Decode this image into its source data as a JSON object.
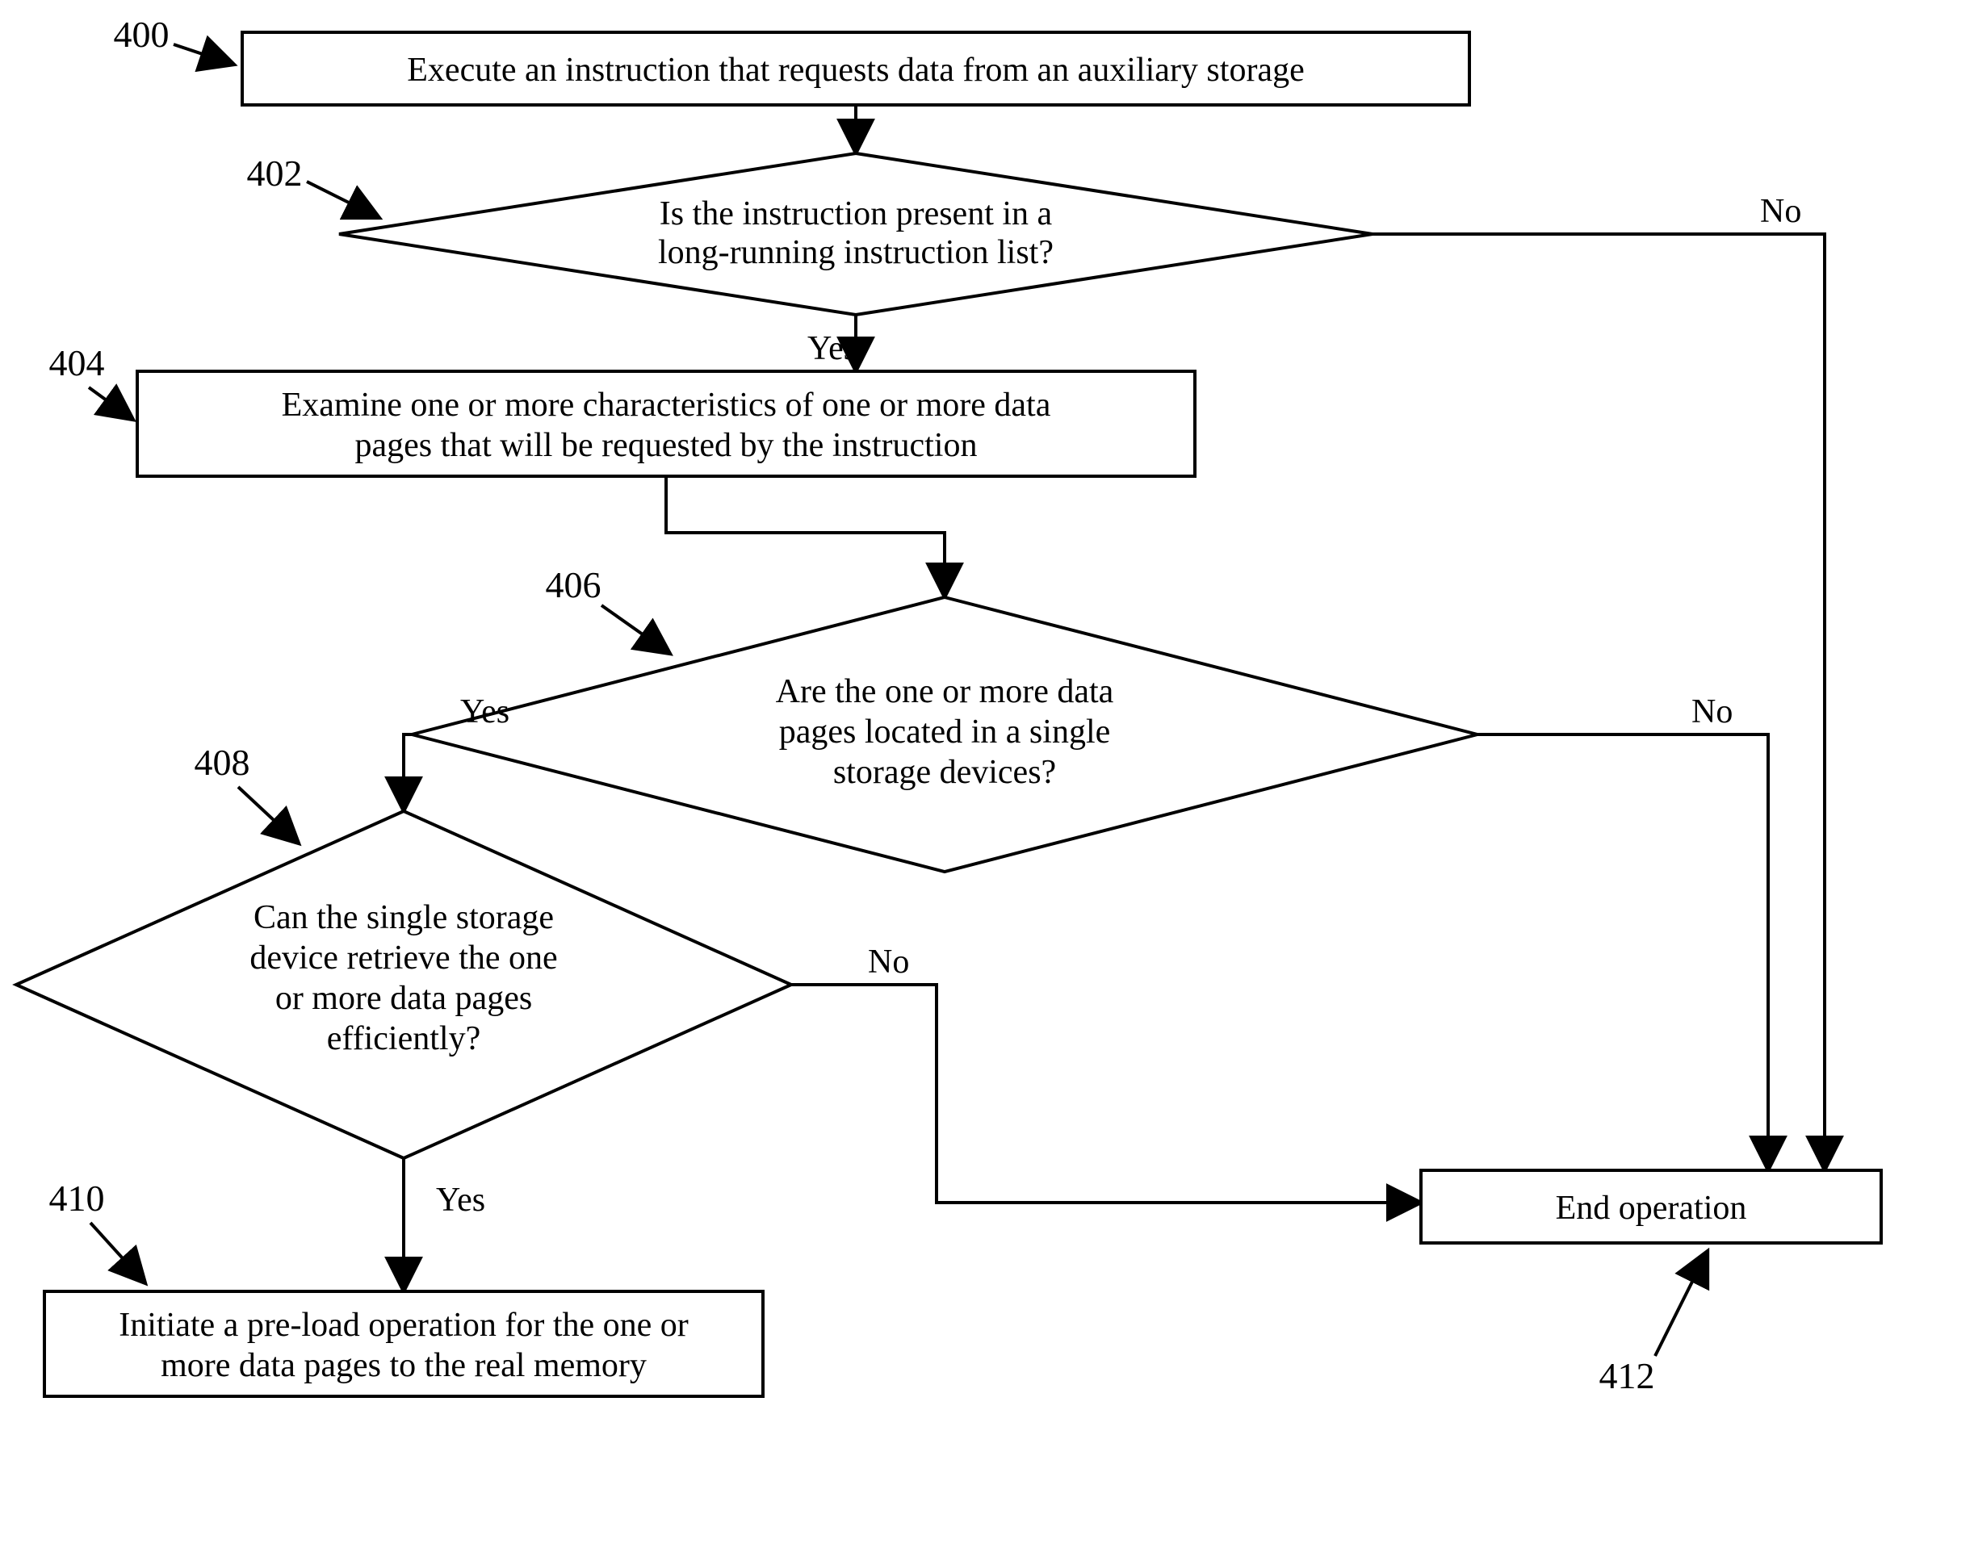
{
  "diagram": {
    "nodes": {
      "n400": {
        "ref": "400",
        "lines": [
          "Execute an instruction that requests data from an auxiliary storage"
        ]
      },
      "n402": {
        "ref": "402",
        "lines": [
          "Is the instruction present in a",
          "long-running instruction list?"
        ]
      },
      "n404": {
        "ref": "404",
        "lines": [
          "Examine one or more characteristics of one or more data",
          "pages that will be requested by the instruction"
        ]
      },
      "n406": {
        "ref": "406",
        "lines": [
          "Are the one or more data",
          "pages located in a single",
          "storage devices?"
        ]
      },
      "n408": {
        "ref": "408",
        "lines": [
          "Can the single storage",
          "device retrieve the one",
          "or more data pages",
          "efficiently?"
        ]
      },
      "n410": {
        "ref": "410",
        "lines": [
          "Initiate a pre-load operation for the one or",
          "more data pages to the real memory"
        ]
      },
      "n412": {
        "ref": "412",
        "lines": [
          "End operation"
        ]
      }
    },
    "edgeLabels": {
      "yes": "Yes",
      "no": "No"
    }
  }
}
